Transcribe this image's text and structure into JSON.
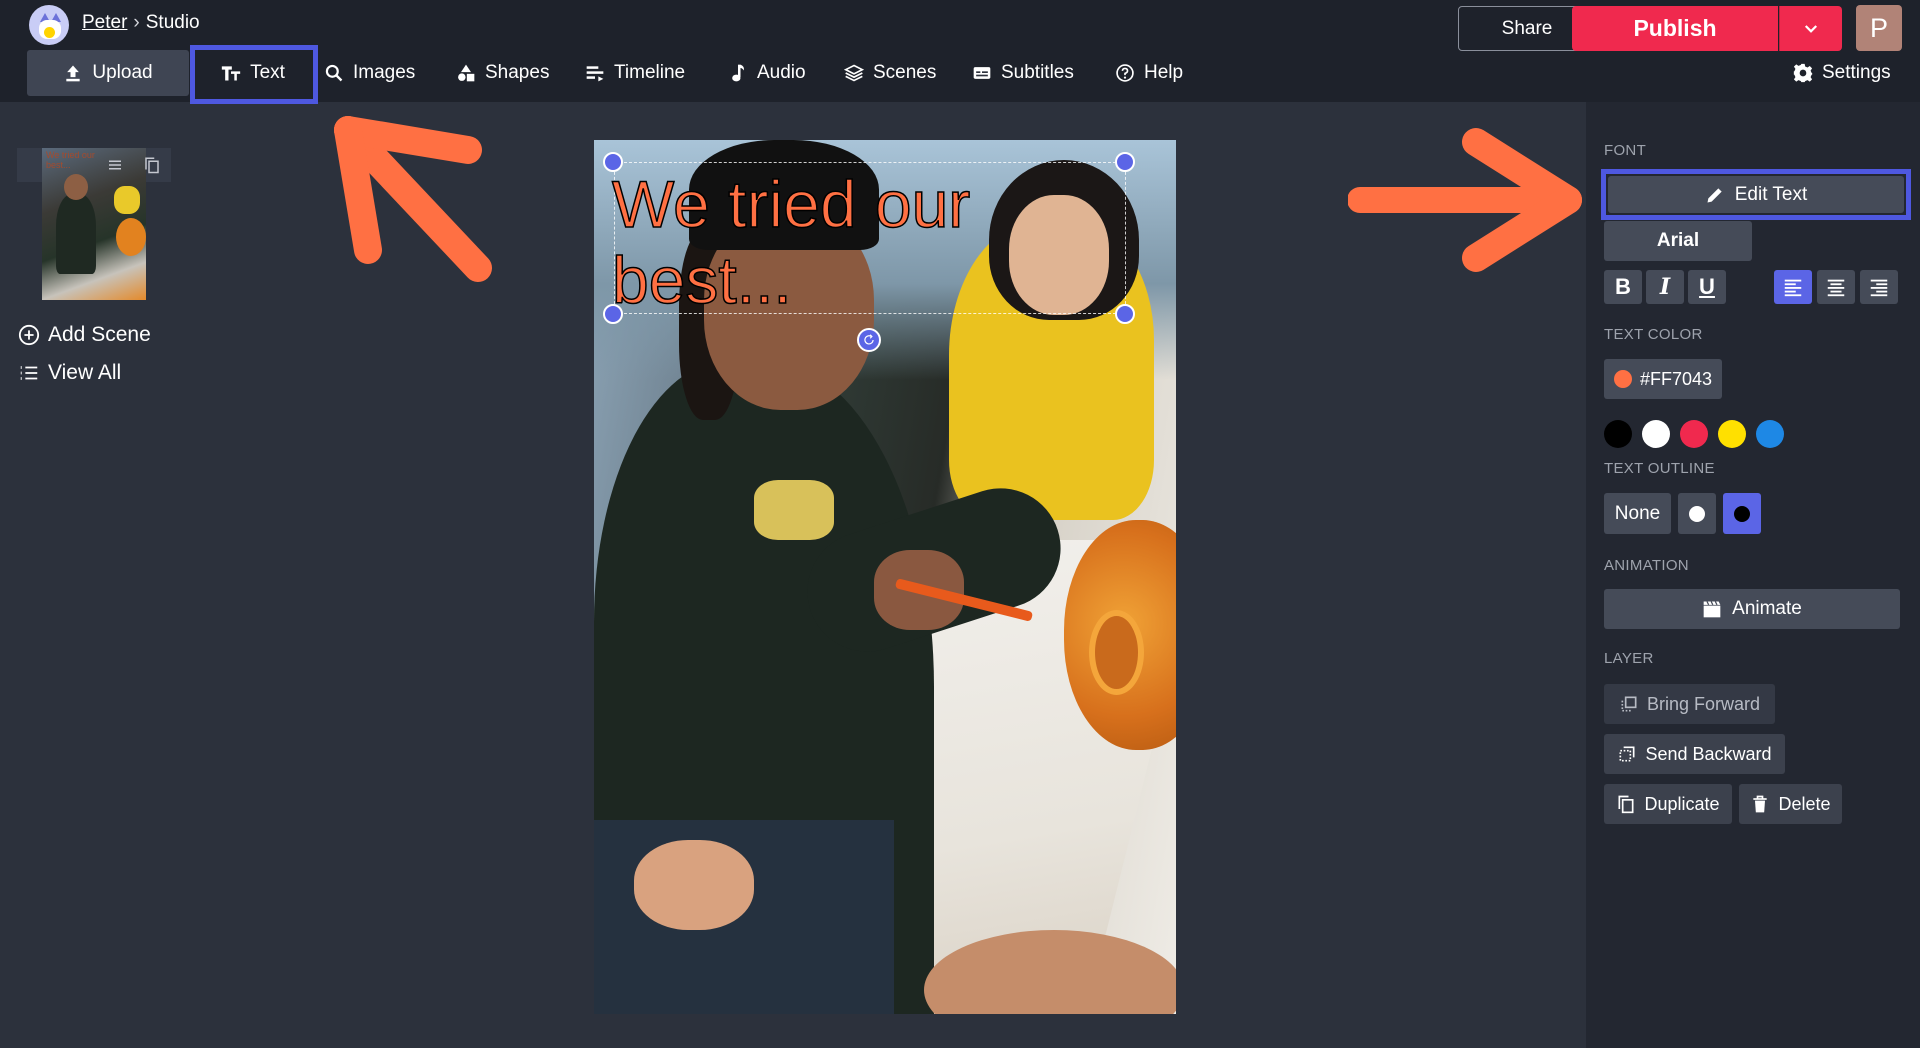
{
  "header": {
    "breadcrumb_user": "Peter",
    "breadcrumb_sep": "›",
    "breadcrumb_page": "Studio",
    "share_label": "Share",
    "publish_label": "Publish",
    "user_initial": "P"
  },
  "toolbar": {
    "upload": "Upload",
    "text": "Text",
    "images": "Images",
    "shapes": "Shapes",
    "timeline": "Timeline",
    "audio": "Audio",
    "scenes": "Scenes",
    "subtitles": "Subtitles",
    "help": "Help",
    "settings": "Settings"
  },
  "scenes_panel": {
    "thumb_caption": "We tried our best...",
    "add_scene": "Add Scene",
    "view_all": "View All"
  },
  "canvas": {
    "overlay_text": "We tried our best..."
  },
  "sidebar": {
    "font_section": "FONT",
    "edit_text": "Edit Text",
    "font_name": "Arial",
    "text_color_section": "TEXT COLOR",
    "text_color_value": "#FF7043",
    "swatches": [
      "#000000",
      "#ffffff",
      "#f0294e",
      "#ffe000",
      "#1e88e5"
    ],
    "text_outline_section": "TEXT OUTLINE",
    "outline_none": "None",
    "animation_section": "ANIMATION",
    "animate": "Animate",
    "layer_section": "LAYER",
    "bring_forward": "Bring Forward",
    "send_backward": "Send Backward",
    "duplicate": "Duplicate",
    "delete": "Delete"
  },
  "colors": {
    "accent": "#5b65e6",
    "publish": "#f0294e",
    "annotation_arrow": "#ff7043"
  }
}
